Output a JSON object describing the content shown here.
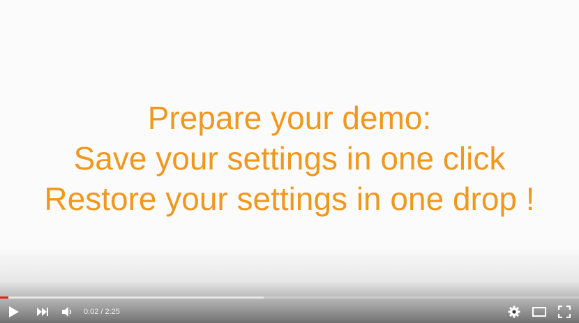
{
  "slide": {
    "line1": "Prepare your demo:",
    "line2": "Save your settings in one click",
    "line3": "Restore your settings in one drop !",
    "text_color": "#f0981e"
  },
  "player": {
    "current_time": "0:02",
    "separator": "/",
    "duration": "2:25",
    "progress_played_fraction": 0.014,
    "progress_buffered_fraction": 0.455,
    "progress_color": "#e52117",
    "icons": {
      "play": "play-icon",
      "next": "next-icon",
      "volume": "volume-icon",
      "settings": "gear-icon",
      "theater": "theater-mode-icon",
      "fullscreen": "fullscreen-icon"
    }
  }
}
